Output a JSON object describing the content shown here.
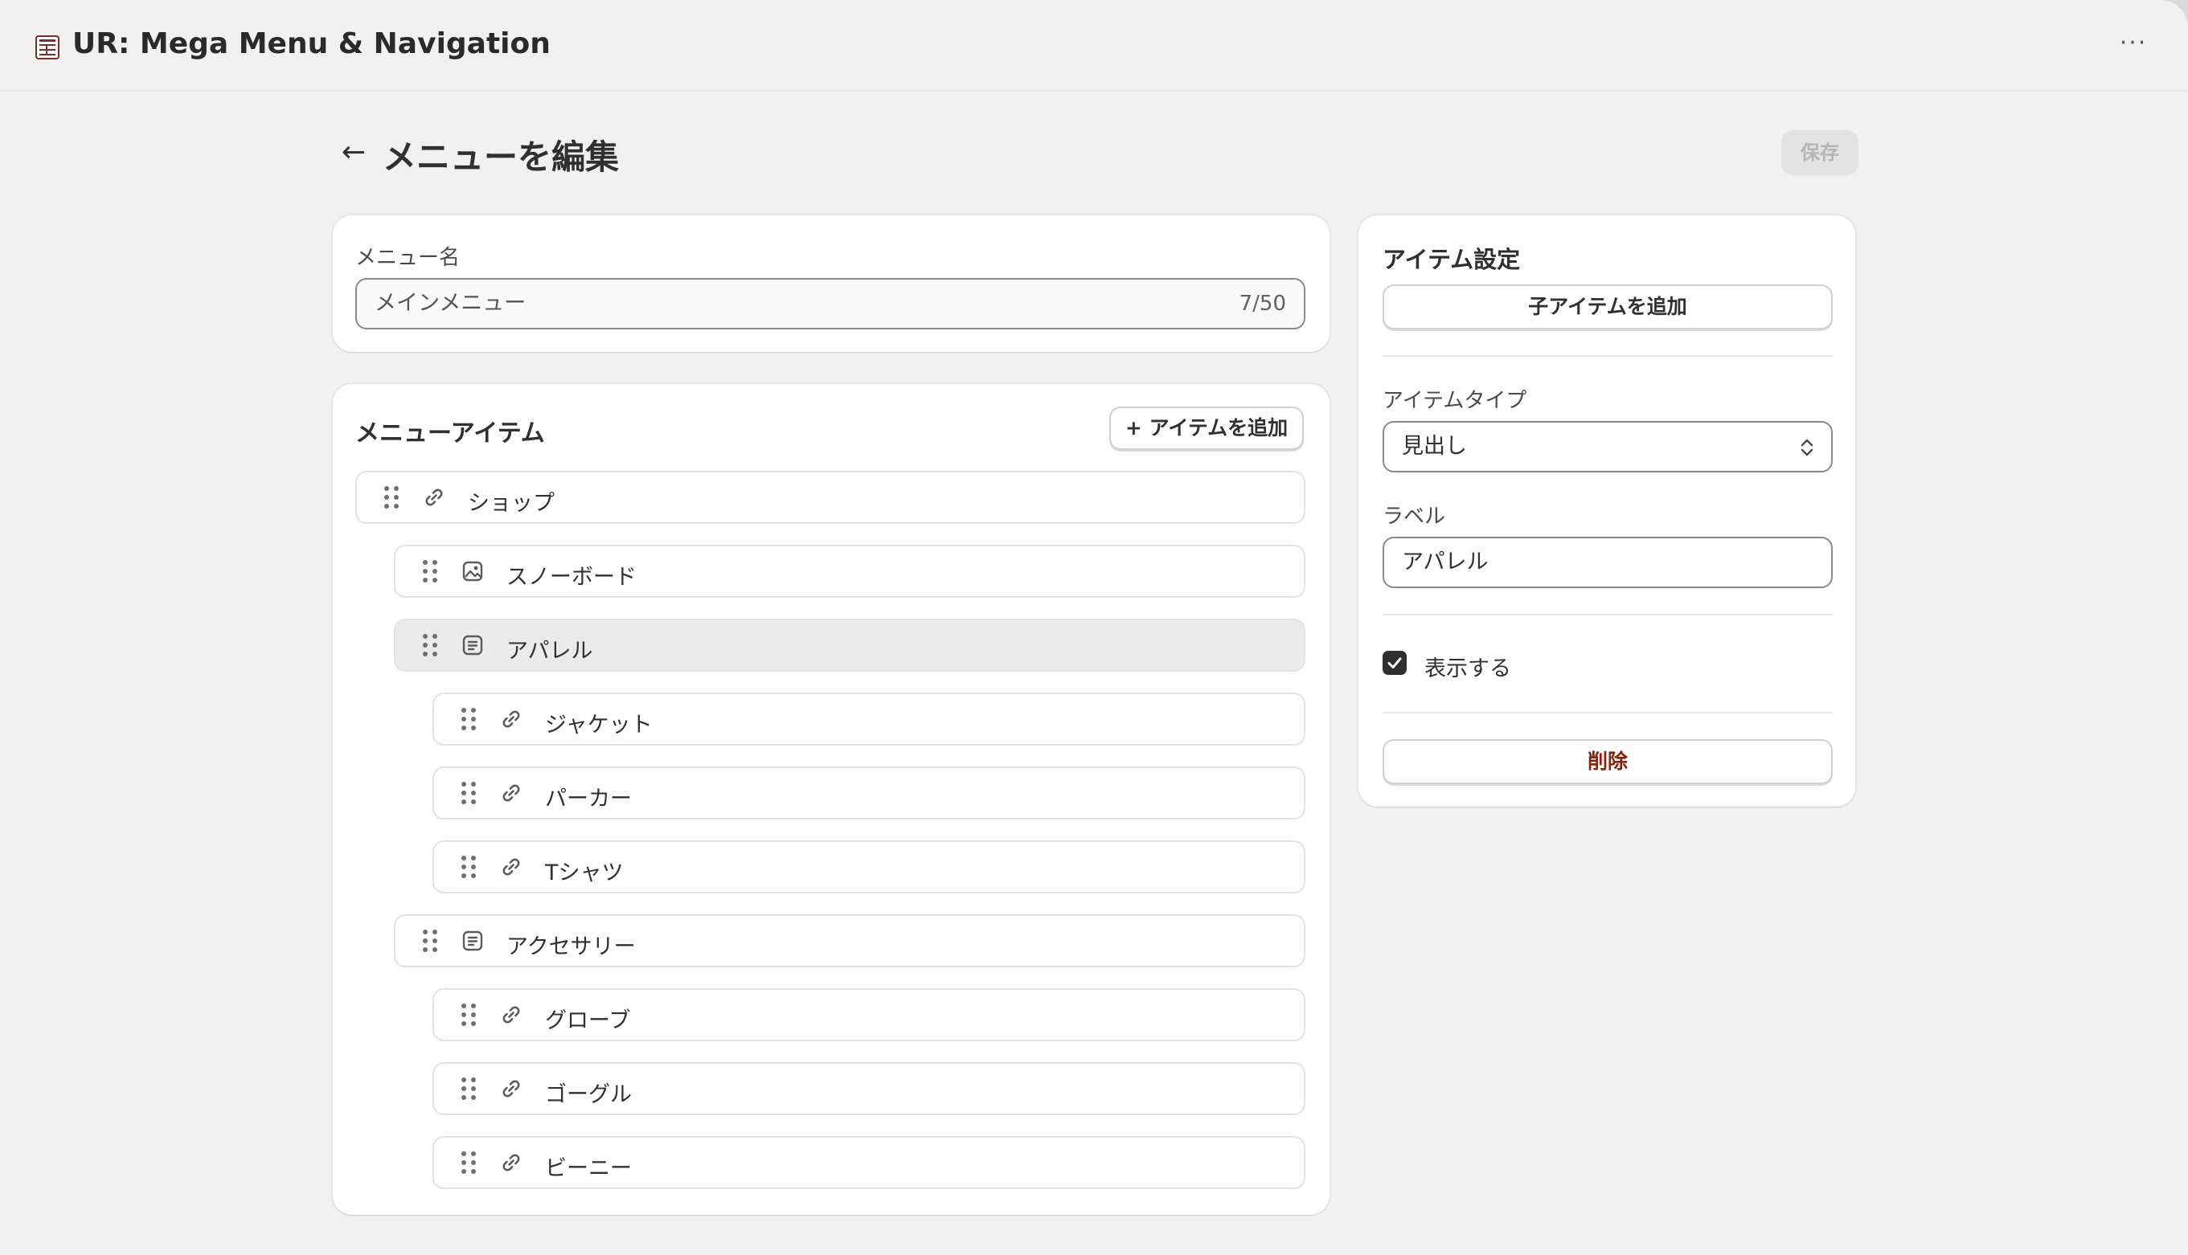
{
  "app": {
    "title": "UR: Mega Menu & Navigation",
    "more_icon": "more-horizontal-icon",
    "more_label": "···"
  },
  "header": {
    "back_icon": "arrow-left-icon",
    "back_glyph": "←",
    "title": "メニューを編集",
    "save_label": "保存"
  },
  "menu_name": {
    "label": "メニュー名",
    "value": "メインメニュー",
    "counter": "7/50"
  },
  "menu_items": {
    "title": "メニューアイテム",
    "add_label": "+ アイテムを追加",
    "items": [
      {
        "label": "ショップ",
        "icon": "link-icon",
        "level": 0
      },
      {
        "label": "スノーボード",
        "icon": "image-icon",
        "level": 1
      },
      {
        "label": "アパレル",
        "icon": "list-icon",
        "level": 1,
        "selected": true
      },
      {
        "label": "ジャケット",
        "icon": "link-icon",
        "level": 2
      },
      {
        "label": "パーカー",
        "icon": "link-icon",
        "level": 2
      },
      {
        "label": "Tシャツ",
        "icon": "link-icon",
        "level": 2
      },
      {
        "label": "アクセサリー",
        "icon": "list-icon",
        "level": 1
      },
      {
        "label": "グローブ",
        "icon": "link-icon",
        "level": 2
      },
      {
        "label": "ゴーグル",
        "icon": "link-icon",
        "level": 2
      },
      {
        "label": "ビーニー",
        "icon": "link-icon",
        "level": 2
      }
    ]
  },
  "settings": {
    "title": "アイテム設定",
    "add_child_label": "子アイテムを追加",
    "type_label": "アイテムタイプ",
    "type_value": "見出し",
    "label_label": "ラベル",
    "label_value": "アパレル",
    "visible_label": "表示する",
    "visible_checked": true,
    "delete_label": "削除"
  },
  "colors": {
    "background": "#f1f1f1",
    "card": "#ffffff",
    "delete": "#8e1f0b",
    "selected_row": "#ebebeb"
  }
}
